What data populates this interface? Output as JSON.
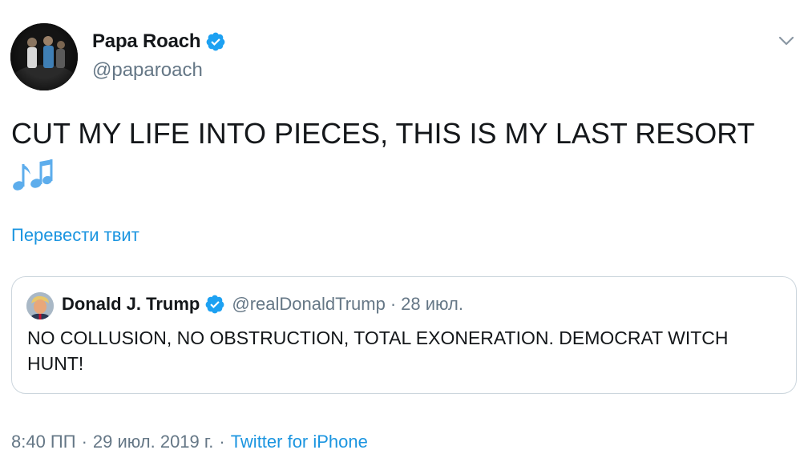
{
  "author": {
    "name": "Papa Roach",
    "handle": "@paparoach"
  },
  "tweet": {
    "text": "CUT MY LIFE INTO PIECES, THIS IS MY LAST RESORT",
    "emoji": "musical-notes-icon",
    "translate_label": "Перевести твит"
  },
  "quoted": {
    "name": "Donald J. Trump",
    "handle": "@realDonaldTrump",
    "separator": "·",
    "date": "28 июл.",
    "text": "NO COLLUSION, NO OBSTRUCTION, TOTAL EXONERATION. DEMOCRAT WITCH HUNT!"
  },
  "meta": {
    "time": "8:40 ПП",
    "separator": "·",
    "date": "29 июл. 2019 г.",
    "source": "Twitter for iPhone"
  },
  "colors": {
    "accent": "#1b95e0",
    "muted": "#657786",
    "text": "#14171a",
    "border": "#ccd6dd"
  }
}
